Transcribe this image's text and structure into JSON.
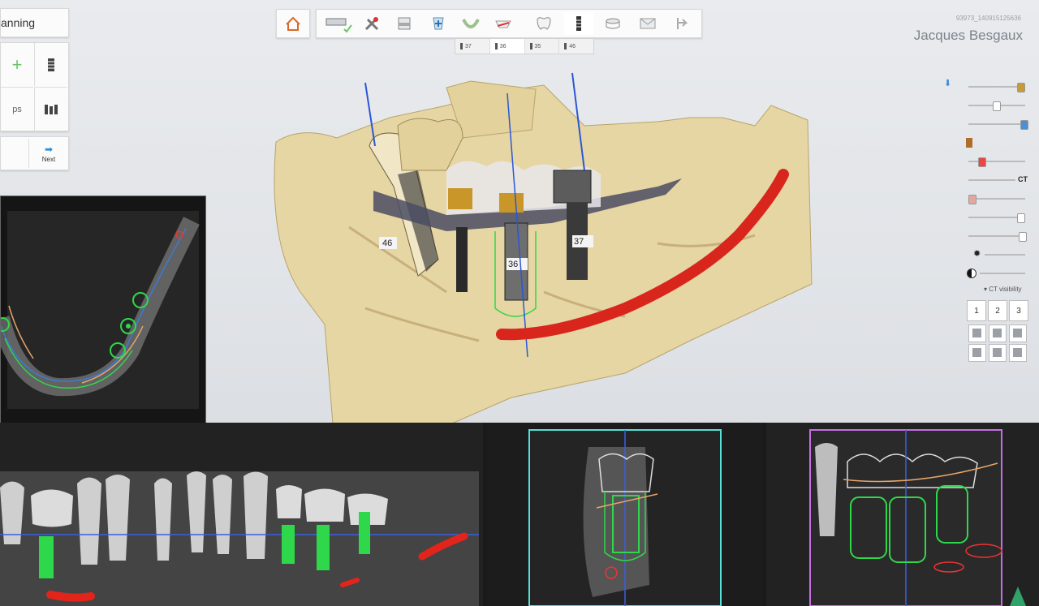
{
  "left_panel": {
    "title": "anning",
    "item_label": "ps",
    "next_label": "Next"
  },
  "toolbar": {
    "tools": [
      "home-icon",
      "scan-check-icon",
      "tools-icon",
      "window-icon",
      "add-implant-icon",
      "arch-icon",
      "crown-edit-icon",
      "tooth-icon",
      "implant-icon",
      "sleeve-icon",
      "envelope-icon",
      "export-icon"
    ]
  },
  "tooth_tabs": [
    {
      "label": "37",
      "selected": false
    },
    {
      "label": "36",
      "selected": true
    },
    {
      "label": "35",
      "selected": false
    },
    {
      "label": "46",
      "selected": false
    }
  ],
  "user": {
    "patient_id": "93973_140915125636",
    "name": "Jacques Besgaux"
  },
  "right_controls": {
    "ct_label": "CT",
    "ct_visibility_label": "CT visibility",
    "view_buttons": [
      "1",
      "2",
      "3"
    ]
  },
  "viewport_3d": {
    "tooth_labels": [
      "46",
      "36",
      "37"
    ]
  },
  "colors": {
    "bone": "#e6d6a4",
    "nerve": "#d9261c",
    "implant_green": "#2fd84a",
    "axis_blue": "#2b56d6",
    "cyan_frame": "#56e0d6",
    "magenta_frame": "#c46fe0"
  }
}
